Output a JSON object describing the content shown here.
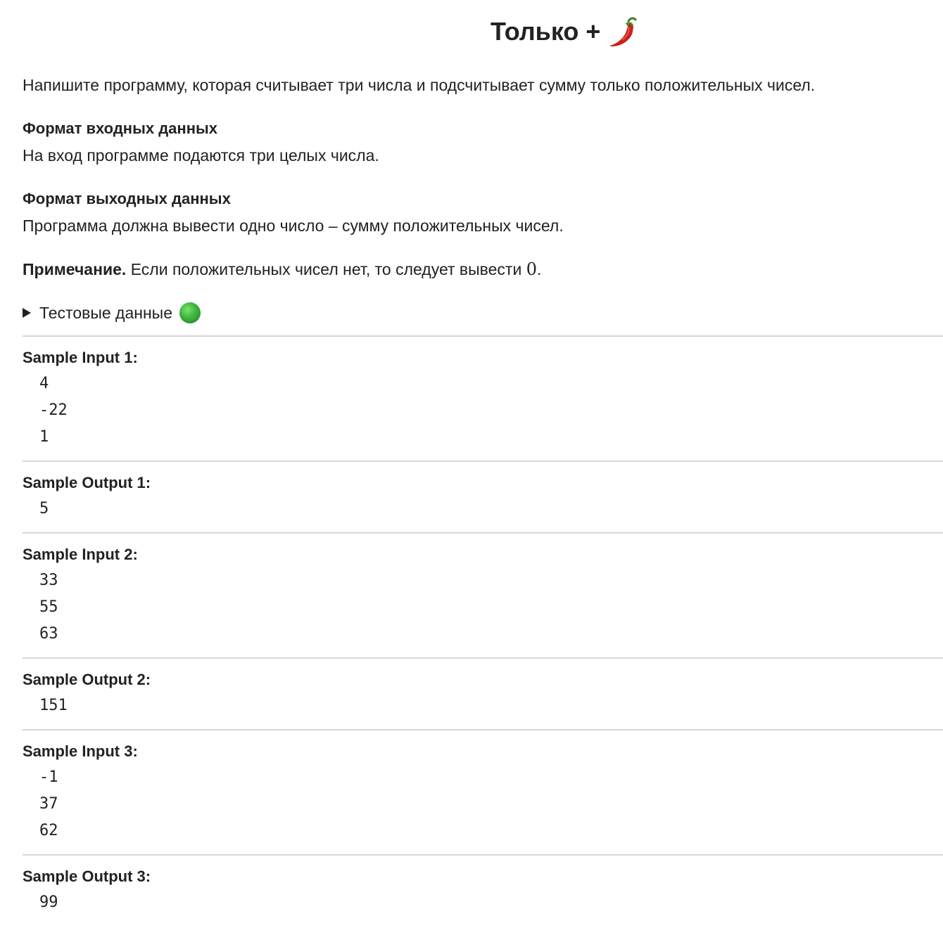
{
  "title": "Только +",
  "title_icon": "chili-pepper-icon",
  "description": "Напишите программу, которая считывает три числа и подсчитывает сумму только положительных чисел.",
  "input_format": {
    "heading": "Формат входных данных",
    "text": "На вход программе подаются три целых числа."
  },
  "output_format": {
    "heading": "Формат выходных данных",
    "text": "Программа должна вывести одно число – сумму положительных чисел."
  },
  "note": {
    "label": "Примечание.",
    "text": " Если положительных чисел нет, то следует вывести ",
    "math": "0",
    "end": "."
  },
  "test_data": {
    "label": "Тестовые данные",
    "icon": "green-circle-icon"
  },
  "samples": [
    {
      "input_label": "Sample Input 1:",
      "input_lines": [
        "4",
        "-22",
        "1"
      ],
      "output_label": "Sample Output 1:",
      "output_lines": [
        "5"
      ]
    },
    {
      "input_label": "Sample Input 2:",
      "input_lines": [
        "33",
        "55",
        "63"
      ],
      "output_label": "Sample Output 2:",
      "output_lines": [
        "151"
      ]
    },
    {
      "input_label": "Sample Input 3:",
      "input_lines": [
        "-1",
        "37",
        "62"
      ],
      "output_label": "Sample Output 3:",
      "output_lines": [
        "99"
      ]
    }
  ]
}
